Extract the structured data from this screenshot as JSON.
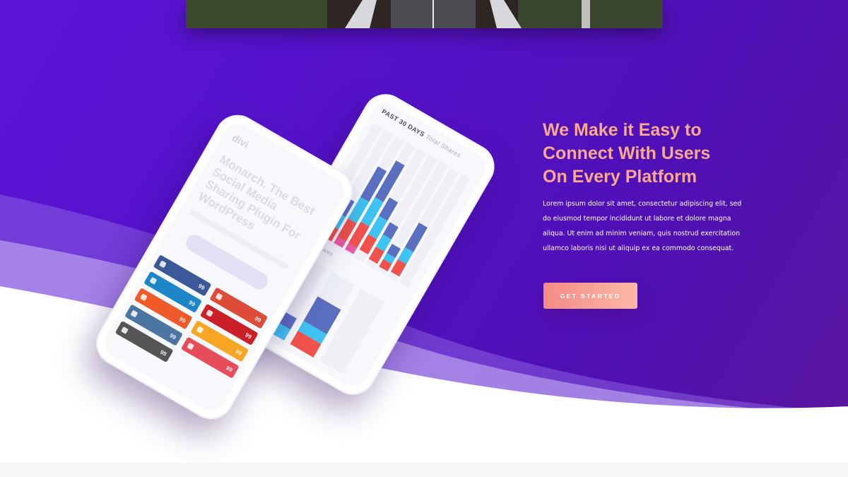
{
  "hero": {
    "headline_lines": [
      "We Make it Easy to",
      "Connect With Users",
      "On Every Platform"
    ],
    "body": "Lorem ipsum dolor sit amet, consectetur adipiscing elit, sed do eiusmod tempor incididunt ut labore et dolore magna aliqua. Ut enim ad minim veniam, quis nostrud exercitation ullamco laboris nisi ut aliquip ex ea commodo consequat.",
    "cta_label": "GET STARTED"
  },
  "phone_back": {
    "label_bold": "PAST 30 DAYS",
    "label_light": "Total Shares",
    "label2": "Total Shares"
  },
  "phone_front": {
    "logo": "divi",
    "heading": "Monarch. The Best Social Media Sharing Plugin For WordPress",
    "share_buttons": [
      {
        "icon": "facebook-icon",
        "count": "99"
      },
      {
        "icon": "googleplus-icon",
        "count": "99"
      },
      {
        "icon": "linkedin-icon",
        "count": "99"
      },
      {
        "icon": "pinterest-icon",
        "count": "99"
      },
      {
        "icon": "reddit-icon",
        "count": "99"
      },
      {
        "icon": "tumblr-icon",
        "count": "99"
      },
      {
        "icon": "vk-icon",
        "count": "99"
      },
      {
        "icon": "love-icon",
        "count": "99"
      },
      {
        "icon": "email-icon",
        "count": "99"
      }
    ]
  },
  "colors": {
    "accent": "#f9a98e",
    "bg_purple": "#5412c8",
    "facebook": "#3b5998",
    "linkedin": "#1e86c8",
    "reddit": "#f05a2b",
    "vk": "#4c75a3",
    "email": "#555555",
    "googleplus": "#dd4b39",
    "pinterest": "#cb2027",
    "tumblr": "#f6a623",
    "love": "#e74c5b"
  }
}
